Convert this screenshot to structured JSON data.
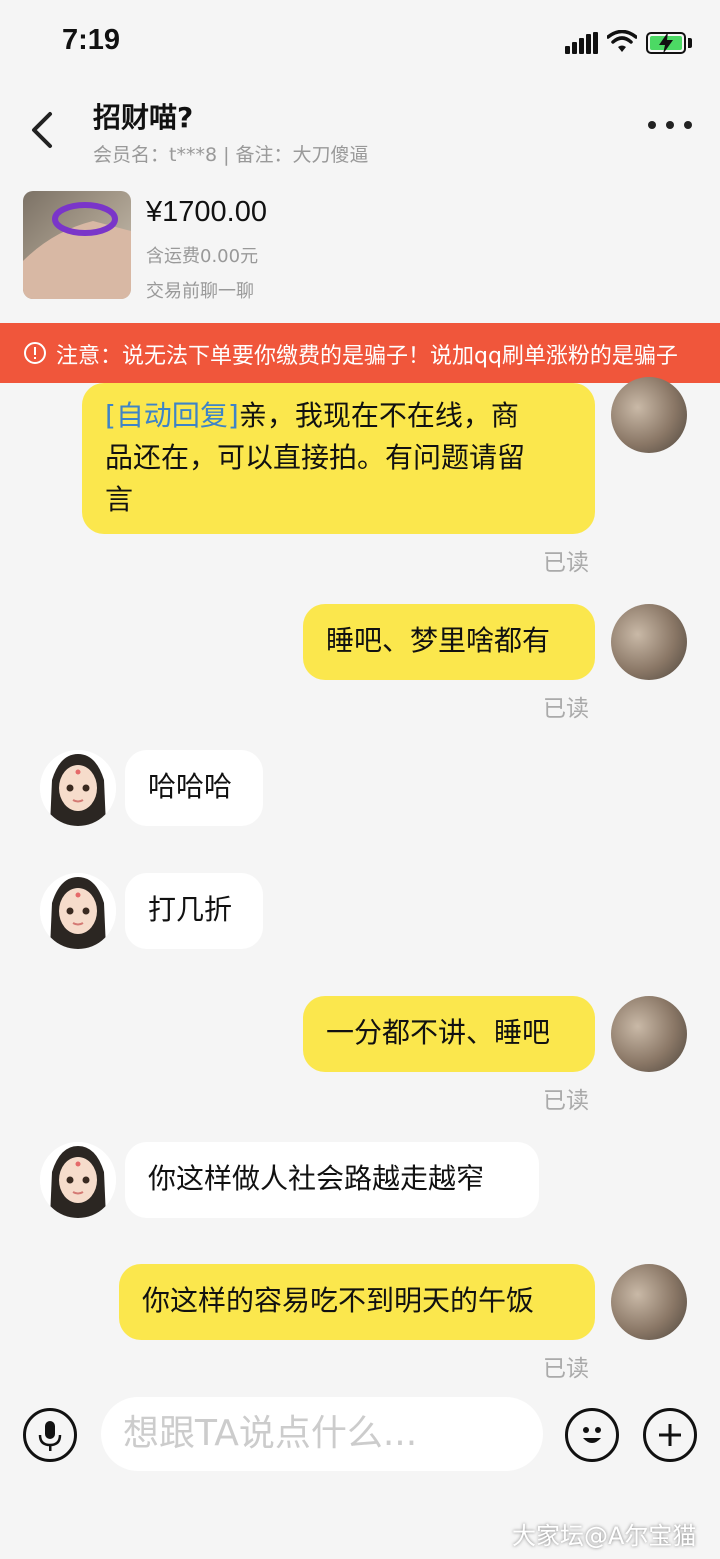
{
  "status_bar": {
    "time": "7:19"
  },
  "header": {
    "title": "招财喵?",
    "subtitle": "会员名：t***8 | 备注：大刀傻逼"
  },
  "product": {
    "price": "¥1700.00",
    "shipping": "含运费0.00元",
    "hint": "交易前聊一聊"
  },
  "notice": {
    "text": "注意：说无法下单要你缴费的是骗子！说加qq刷单涨粉的是骗子"
  },
  "messages": [
    {
      "from": "me",
      "auto_tag": "[自动回复]",
      "line1": "亲，我现在不在线，商",
      "line2": "品还在，可以直接拍。有问题请留",
      "line3": "言",
      "status": "已读"
    },
    {
      "from": "me",
      "text": "睡吧、梦里啥都有",
      "status": "已读"
    },
    {
      "from": "them",
      "text": "哈哈哈"
    },
    {
      "from": "them",
      "text": "打几折"
    },
    {
      "from": "me",
      "text": "一分都不讲、睡吧",
      "status": "已读"
    },
    {
      "from": "them",
      "text": "你这样做人社会路越走越窄"
    },
    {
      "from": "me",
      "text": "你这样的容易吃不到明天的午饭",
      "status": "已读"
    }
  ],
  "input": {
    "placeholder": "想跟TA说点什么..."
  },
  "watermark": "大家坛@A尔宝猫",
  "colors": {
    "my_bubble": "#fbe74d",
    "notice_bg": "#f0563b",
    "auto_tag": "#3e84c7",
    "background": "#f5f5f5"
  },
  "icons": [
    "back-chevron-icon",
    "more-dots-icon",
    "warning-icon",
    "microphone-icon",
    "emoji-icon",
    "plus-icon"
  ]
}
